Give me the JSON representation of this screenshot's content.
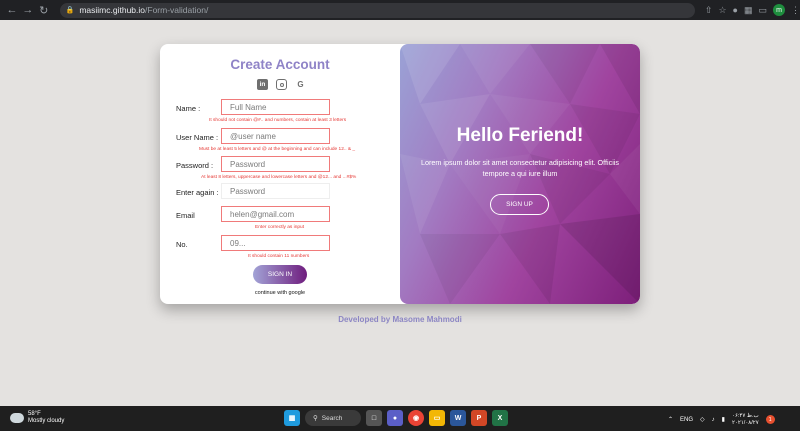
{
  "browser": {
    "url_host": "masiimc.github.io",
    "url_path": "/Form-validation/",
    "profile_initial": "m"
  },
  "form": {
    "title": "Create Account",
    "fields": [
      {
        "label": "Name :",
        "placeholder": "Full Name",
        "error": "It should not contain @#.. and numbers, contain at least 3 letters"
      },
      {
        "label": "User Name :",
        "placeholder": "@user name",
        "error": "Must be at least 5 letters and @ at the beginning and can include 12.. & _"
      },
      {
        "label": "Password :",
        "placeholder": "Password",
        "error": "At least 8 letters, uppercase and lowercase letters and @12... and ...#$%"
      },
      {
        "label": "Enter again :",
        "placeholder": "Password",
        "error": ""
      },
      {
        "label": "Email",
        "placeholder": "helen@gmail.com",
        "error": "Enter correctly as input"
      },
      {
        "label": "No.",
        "placeholder": "09...",
        "error": "It should contain 11 numbers"
      }
    ],
    "signin_label": "SIGN IN",
    "google_note": "continue with google"
  },
  "overlay": {
    "heading": "Hello Feriend!",
    "text": "Lorem ipsum dolor sit amet consectetur adipisicing elit. Officiis tempore a qui iure illum",
    "signup_label": "SIGN UP"
  },
  "footer": {
    "credit_prefix": "Developed by ",
    "credit_name": "Masome Mahmodi"
  },
  "taskbar": {
    "temperature": "58°F",
    "condition": "Mostly cloudy",
    "search_label": "Search",
    "language": "ENG",
    "time": "ب.ظ ۰۶:۴۷",
    "date": "۲۰۲۱/۰۸/۲۷"
  },
  "colors": {
    "accent": "#8f83c7",
    "error": "#e53935",
    "gradient_start": "#a2a3d6",
    "gradient_end": "#6f1d7e"
  }
}
